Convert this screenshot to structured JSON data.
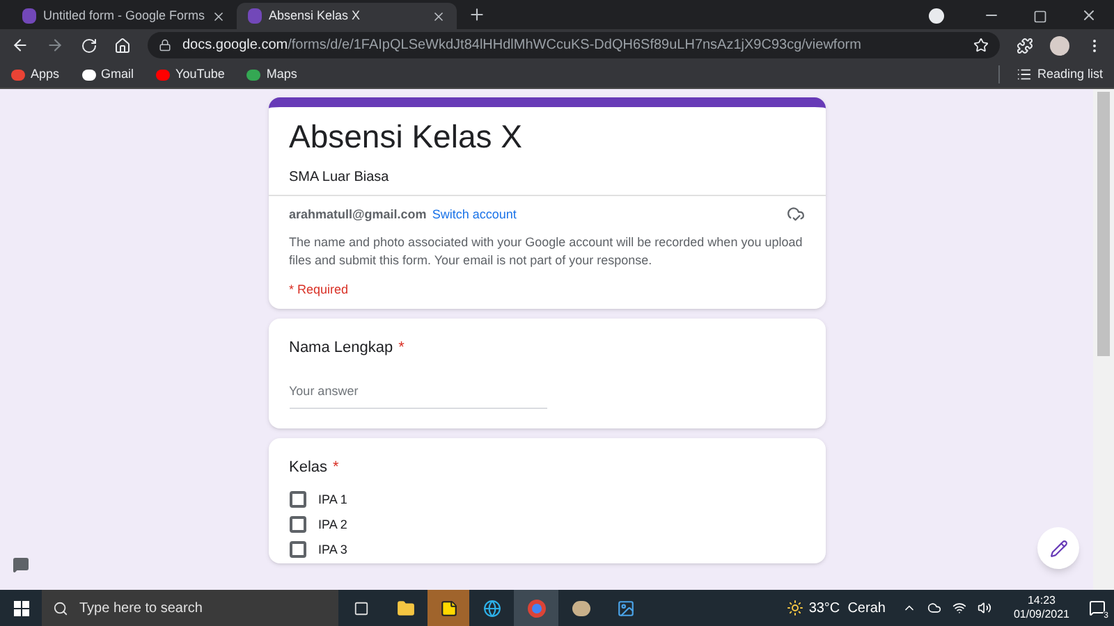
{
  "browser": {
    "tabs": [
      {
        "title": "Untitled form - Google Forms",
        "selected": false
      },
      {
        "title": "Absensi Kelas X",
        "selected": true
      }
    ],
    "url_host": "docs.google.com",
    "url_path": "/forms/d/e/1FAIpQLSeWkdJt84lHHdlMhWCcuKS-DdQH6Sf89uLH7nsAz1jX9C93cg/viewform",
    "bookmarks": [
      "Apps",
      "Gmail",
      "YouTube",
      "Maps"
    ],
    "reading_list": "Reading list"
  },
  "form": {
    "title": "Absensi Kelas X",
    "description": "SMA Luar Biasa",
    "email": "arahmatull@gmail.com",
    "switch_account": "Switch account",
    "notice": "The name and photo associated with your Google account will be recorded when you upload files and submit this form. Your email is not part of your response.",
    "required_note": "* Required",
    "questions": [
      {
        "kind": "text",
        "title": "Nama Lengkap",
        "required_mark": "*",
        "placeholder": "Your answer"
      },
      {
        "kind": "checkbox",
        "title": "Kelas",
        "required_mark": "*",
        "options": [
          {
            "label": "IPA 1",
            "checked": false
          },
          {
            "label": "IPA 2",
            "checked": false
          },
          {
            "label": "IPA 3",
            "checked": false
          }
        ]
      }
    ]
  },
  "taskbar": {
    "search_placeholder": "Type here to search",
    "weather": "33°C  Cerah",
    "time": "14:23",
    "date": "01/09/2021",
    "notification_count": "3"
  }
}
